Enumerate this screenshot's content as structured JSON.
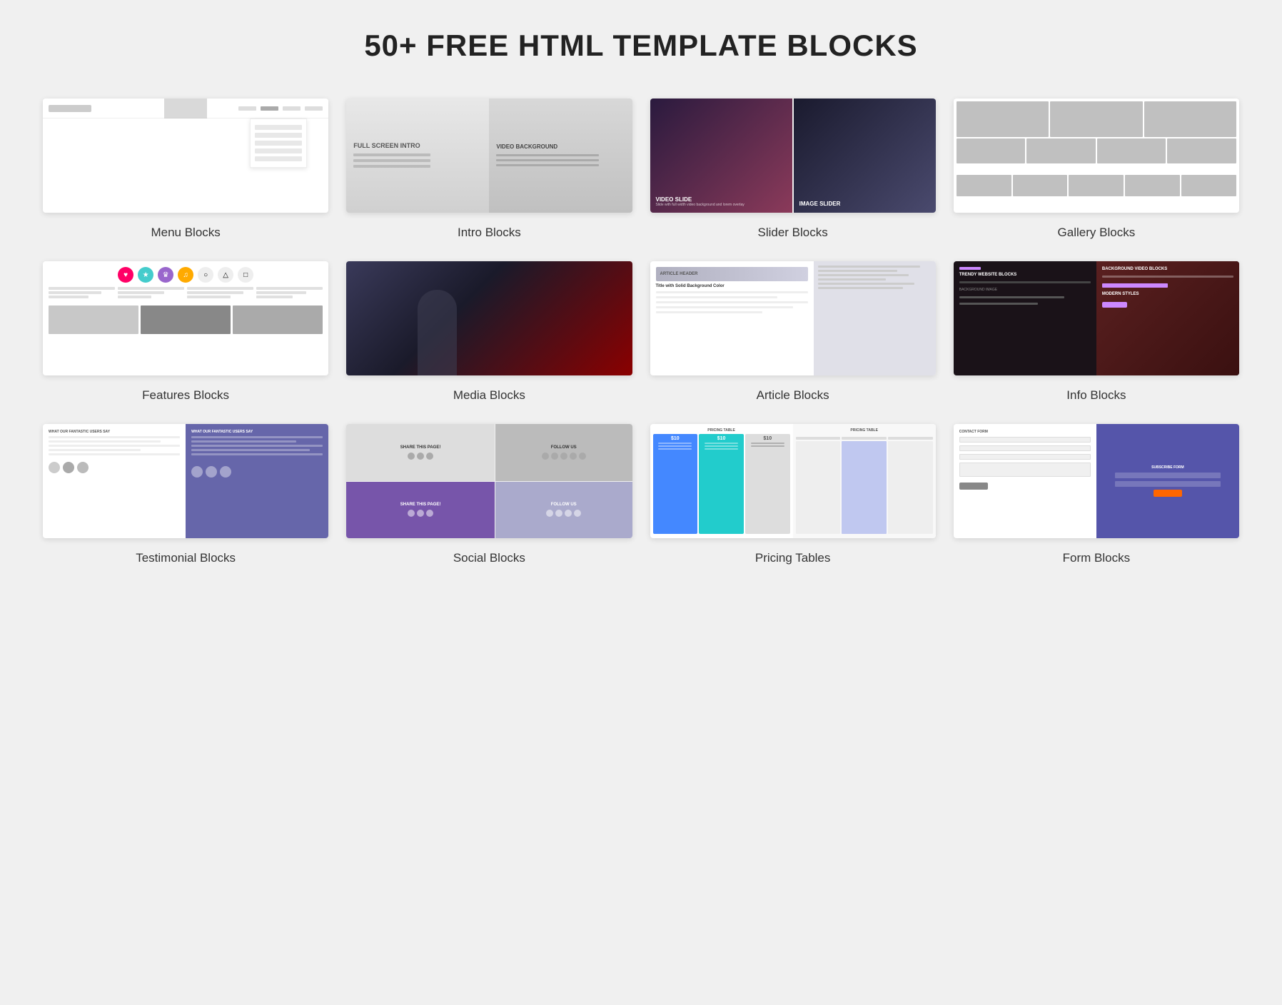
{
  "page": {
    "title": "50+ FREE HTML TEMPLATE BLOCKS"
  },
  "blocks": [
    {
      "id": "menu",
      "label": "Menu Blocks"
    },
    {
      "id": "intro",
      "label": "Intro Blocks"
    },
    {
      "id": "slider",
      "label": "Slider Blocks"
    },
    {
      "id": "gallery",
      "label": "Gallery Blocks"
    },
    {
      "id": "features",
      "label": "Features Blocks"
    },
    {
      "id": "media",
      "label": "Media Blocks"
    },
    {
      "id": "article",
      "label": "Article Blocks"
    },
    {
      "id": "info",
      "label": "Info Blocks"
    },
    {
      "id": "testimonial",
      "label": "Testimonial Blocks"
    },
    {
      "id": "social",
      "label": "Social Blocks"
    },
    {
      "id": "pricing",
      "label": "Pricing Tables"
    },
    {
      "id": "form",
      "label": "Form Blocks"
    }
  ],
  "intro_preview": {
    "left_title": "FULL SCREEN INTRO",
    "right_title": "VIDEO BACKGROUND"
  },
  "slider_preview": {
    "left_title": "VIDEO SLIDE",
    "right_title": "IMAGE SLIDER"
  },
  "social_preview": {
    "top_share": "SHARE THIS PAGE!",
    "top_follow": "FOLLOW US",
    "bottom_share": "SHARE THIS PAGE!",
    "bottom_follow": "FOLLOW US"
  },
  "form_preview": {
    "left_title": "CONTACT FORM",
    "right_title": "SUBSCRIBE FORM"
  },
  "info_preview": {
    "left_top": "TRENDY WEBSITE BLOCKS",
    "left_mid": "BACKGROUND IMAGE",
    "right_title": "BACKGROUND VIDEO BLOCKS",
    "right_sub": "MODERN STYLES"
  },
  "article_preview": {
    "header": "ARTICLE HEADER",
    "title": "Title with Solid Background Color"
  },
  "pricing_preview": {
    "title": "PRICING TABLE",
    "prices": [
      "$10",
      "$10",
      "$10"
    ]
  },
  "testimonial_preview": {
    "left_title": "WHAT OUR FANTASTIC USERS SAY",
    "right_title": "WHAT OUR FANTASTIC USERS SAY"
  }
}
